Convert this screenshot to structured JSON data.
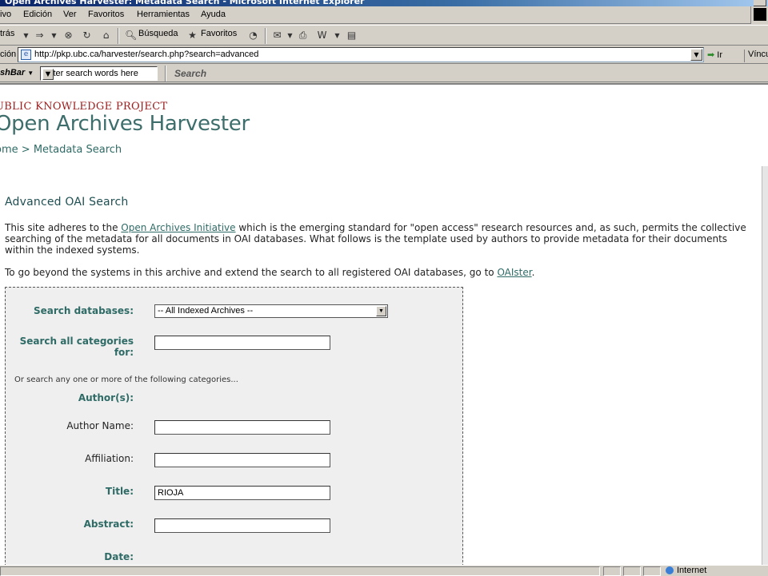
{
  "window": {
    "title": "Open Archives Harvester: Metadata Search - Microsoft Internet Explorer"
  },
  "menu": {
    "items": [
      "ivo",
      "Edición",
      "Ver",
      "Favoritos",
      "Herramientas",
      "Ayuda"
    ]
  },
  "toolbar": {
    "back_label": "trás",
    "favorites_label": "Favoritos",
    "search_label": "Búsqueda"
  },
  "address": {
    "label": "ción",
    "url": "http://pkp.ubc.ca/harvester/search.php?search=advanced",
    "go_label": "Ir",
    "links_label": "Víncu"
  },
  "flashbar": {
    "name": "shBar",
    "search_placeholder": "Enter search words here",
    "search_button": "Search"
  },
  "site": {
    "project": "UBLIC KNOWLEDGE PROJECT",
    "title": "Open Archives Harvester",
    "breadcrumb_home": "ome",
    "breadcrumb_sep": ">",
    "breadcrumb_current": "Metadata Search"
  },
  "page": {
    "heading": "Advanced OAI Search",
    "intro_before": "This site adheres to the ",
    "intro_link": "Open Archives Initiative",
    "intro_after": " which is the emerging standard for \"open access\" research resources and, as such, permits the collective searching of the metadata for all documents in OAI databases. What follows is the template used by authors to provide metadata for their documents within the indexed systems.",
    "beyond_before": "To go beyond the systems in this archive and extend the search to all registered OAI databases, go to ",
    "beyond_link": "OAIster",
    "beyond_after": "."
  },
  "form": {
    "databases_label": "Search databases:",
    "databases_selected": "-- All Indexed Archives --",
    "all_categories_label": "Search all categories for:",
    "all_categories_value": "",
    "or_text": "Or search any one or more of the following categories...",
    "authors_label": "Author(s):",
    "author_name_label": "Author Name:",
    "author_name_value": "",
    "affiliation_label": "Affiliation:",
    "affiliation_value": "",
    "title_label": "Title:",
    "title_value": "RIOJA",
    "abstract_label": "Abstract:",
    "abstract_value": "",
    "date_label": "Date:"
  },
  "status": {
    "zone": "Internet"
  },
  "colors": {
    "accent_teal": "#2f6b66",
    "project_red": "#9b1c1c",
    "titlebar_blue": "#0a246a"
  }
}
